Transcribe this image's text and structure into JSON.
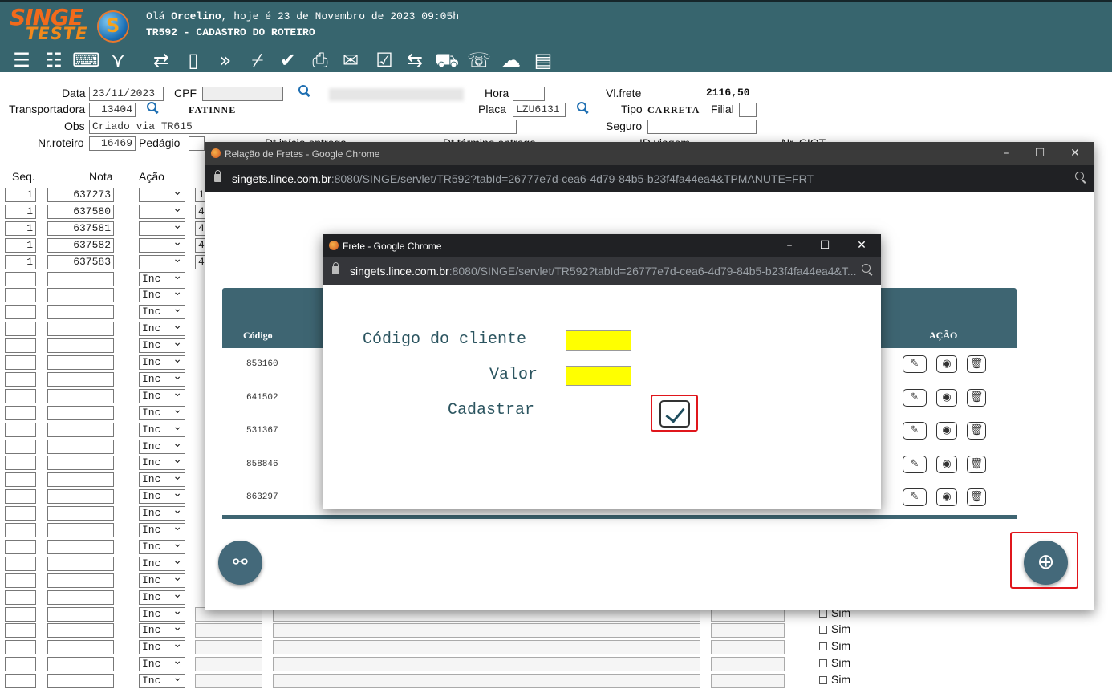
{
  "header": {
    "logo_top": "SINGE",
    "logo_bottom": "TESTE",
    "globe_letter": "S",
    "greeting_prefix": "Olá ",
    "greeting_user": "Orcelino",
    "greeting_suffix": ", hoje é 23 de Novembro de 2023 09:05h",
    "screen_title": "TR592 - CADASTRO DO ROTEIRO"
  },
  "toolbar": {
    "icons": [
      "list-icon",
      "checklist-icon",
      "keyboard-icon",
      "collapse-icon",
      "refresh-icon",
      "book-icon",
      "forward-icon",
      "broom-icon",
      "check-icon",
      "printer-icon",
      "email-icon",
      "tasks-icon",
      "transfer-icon",
      "truck-icon",
      "phone-icon",
      "cloud-upload-icon",
      "clipboard-icon"
    ]
  },
  "form": {
    "data_label": "Data",
    "data_value": "23/11/2023",
    "cpf_label": "CPF",
    "hora_label": "Hora",
    "vlfrete_label": "Vl.frete",
    "vlfrete_value": "2116,50",
    "transportadora_label": "Transportadora",
    "transportadora_value": "13404",
    "transportadora_name": "FATINNE",
    "placa_label": "Placa",
    "placa_value": "LZU6131",
    "tipo_label": "Tipo",
    "tipo_value": "CARRETA",
    "filial_label": "Filial",
    "obs_label": "Obs",
    "obs_value": "Criado via TR615",
    "seguro_label": "Seguro",
    "nrroteiro_label": "Nr.roteiro",
    "nrroteiro_value": "16469",
    "pedagio_label": "Pedágio",
    "dtinicio_label": "Dt.início entrega",
    "dttermino_label": "Dt.término entrega",
    "idviagem_label": "ID viagem",
    "nrciot_label": "Nr. CIOT"
  },
  "grid": {
    "headers": {
      "seq": "Seq.",
      "nota": "Nota",
      "acao": "Ação"
    },
    "filled_rows": [
      {
        "seq": "1",
        "nota": "637273",
        "next": "1"
      },
      {
        "seq": "1",
        "nota": "637580",
        "next": "4"
      },
      {
        "seq": "1",
        "nota": "637581",
        "next": "4"
      },
      {
        "seq": "1",
        "nota": "637582",
        "next": "4"
      },
      {
        "seq": "1",
        "nota": "637583",
        "next": "4"
      }
    ],
    "empty_action": "Inc",
    "sim_label": "Sim"
  },
  "window_fretes": {
    "title": "Relação de Fretes - Google Chrome",
    "url_host": "singets.lince.com.br",
    "url_rest": ":8080/SINGE/servlet/TR592?tabId=26777e7d-cea6-4d79-84b5-b23f4fa44ea4&TPMANUTE=FRT",
    "col_codigo": "Código",
    "col_acao": "AÇÃO",
    "rows": [
      "853160",
      "641502",
      "531367",
      "858846",
      "863297"
    ]
  },
  "window_frete": {
    "title": "Frete - Google Chrome",
    "url_host": "singets.lince.com.br",
    "url_rest": ":8080/SINGE/servlet/TR592?tabId=26777e7d-cea6-4d79-84b5-b23f4fa44ea4&T...",
    "codigo_label": "Código do cliente",
    "valor_label": "Valor",
    "cadastrar_label": "Cadastrar"
  },
  "colors": {
    "header_bg": "#37656e",
    "table_head_bg": "#3e6572",
    "highlight_yellow": "#ffff00",
    "annotation_red": "#e0161c",
    "logo_orange": "#f26a1b"
  }
}
